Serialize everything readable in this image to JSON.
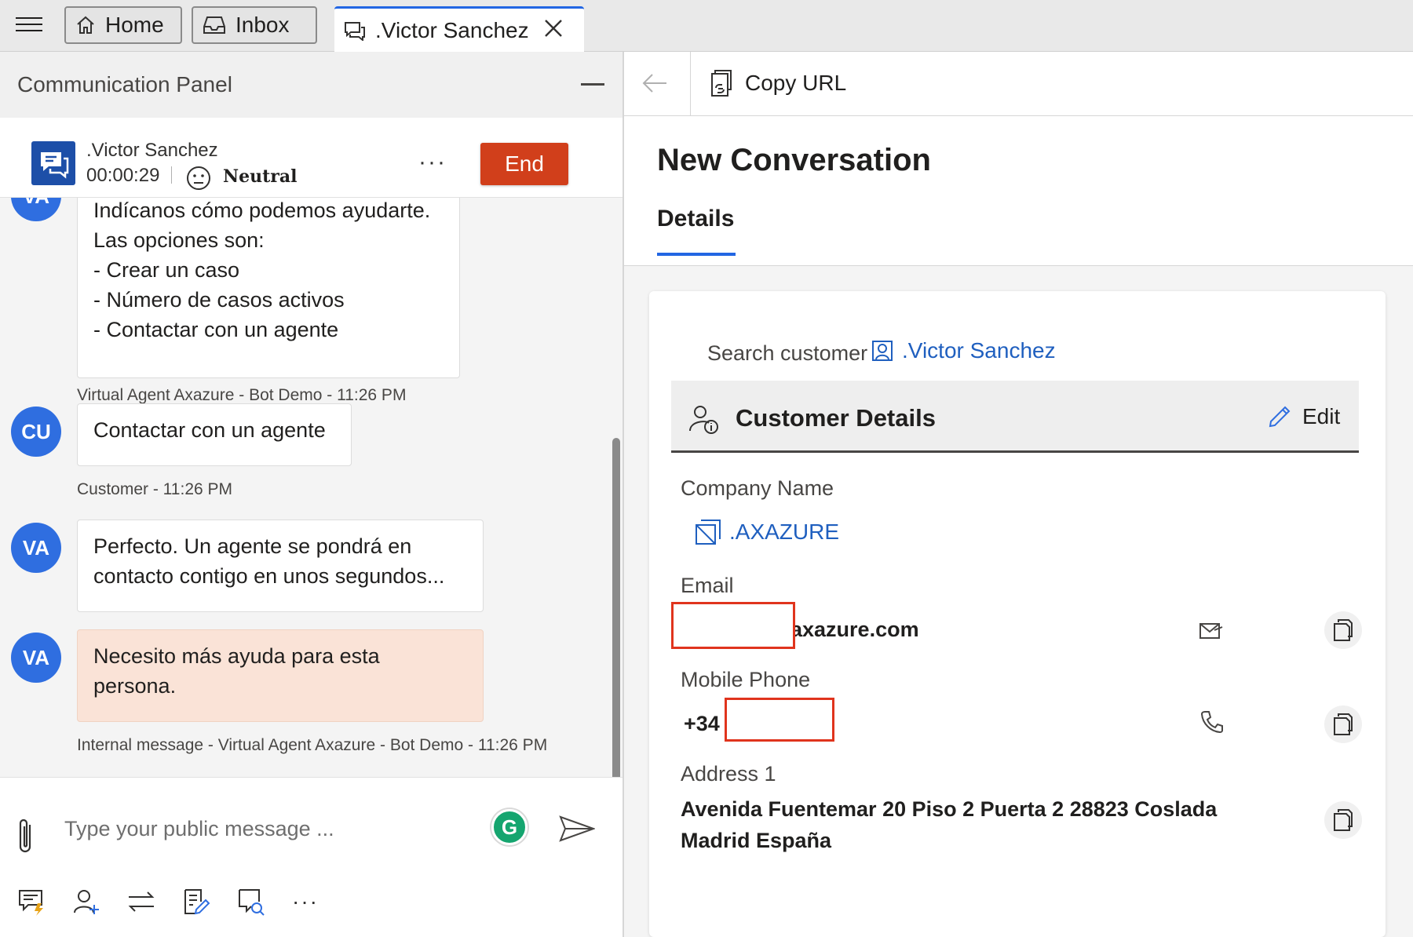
{
  "tabs": {
    "home": "Home",
    "inbox": "Inbox",
    "active": ".Victor Sanchez"
  },
  "left_panel": {
    "title": "Communication Panel",
    "session": {
      "customer_name": ".Victor Sanchez",
      "timer": "00:00:29",
      "sentiment": "Neutral",
      "end_label": "End"
    },
    "messages": [
      {
        "avatar": "VA",
        "lines": [
          "Indícanos cómo podemos ayudarte.",
          "Las opciones son:",
          "- Crear un caso",
          "- Número de casos activos",
          "- Contactar con un agente"
        ],
        "meta": "Virtual Agent Axazure - Bot Demo - 11:26 PM"
      },
      {
        "avatar": "CU",
        "lines": [
          "Contactar con un agente"
        ],
        "meta": "Customer - 11:26 PM"
      },
      {
        "avatar": "VA",
        "lines": [
          "Perfecto. Un agente se pondrá en",
          "contacto contigo en unos segundos..."
        ],
        "meta": ""
      },
      {
        "avatar": "VA",
        "lines": [
          "Necesito más ayuda para esta",
          "persona."
        ],
        "meta": "Internal message - Virtual Agent Axazure - Bot Demo - 11:26 PM",
        "internal": true
      }
    ],
    "composer": {
      "placeholder": "Type your public message ...",
      "grammarly": "G",
      "more": "···"
    }
  },
  "right_panel": {
    "copy_url": "Copy URL",
    "form_title": "New Conversation",
    "tab_details": "Details",
    "search_customer_label": "Search customer",
    "customer_link": ".Victor Sanchez",
    "section_title": "Customer Details",
    "edit_label": "Edit",
    "company_label": "Company Name",
    "company_value": ".AXAZURE",
    "email_label": "Email",
    "email_value_visible": "axazure.com",
    "mobile_label": "Mobile Phone",
    "mobile_value_visible": "+34",
    "address_label": "Address 1",
    "address_value": "Avenida Fuentemar 20 Piso 2 Puerta 2 28823 Coslada Madrid España"
  },
  "colors": {
    "accent": "#2266e3",
    "end_button": "#d13f1b",
    "avatar": "#2f6ee0",
    "internal_bubble": "#fae3d7",
    "link": "#1f5fbf",
    "redaction": "#e0341d"
  }
}
